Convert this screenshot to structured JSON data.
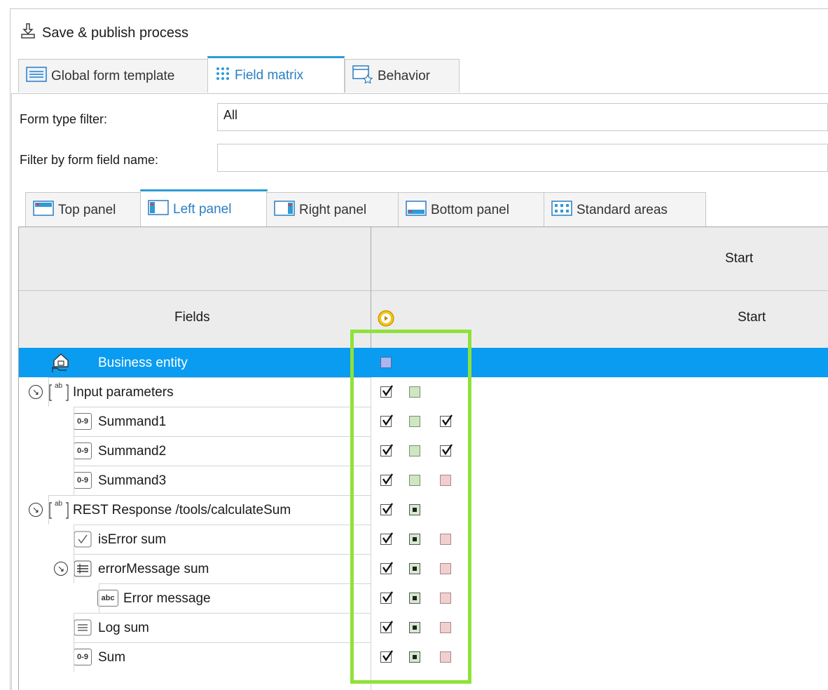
{
  "toolbar": {
    "save_label": "Save & publish process"
  },
  "top_tabs": [
    {
      "label": "Global form template",
      "icon": "form-template-icon"
    },
    {
      "label": "Field matrix",
      "icon": "field-matrix-icon"
    },
    {
      "label": "Behavior",
      "icon": "behavior-icon"
    }
  ],
  "filters": {
    "form_type_label": "Form type filter:",
    "form_type_value": "All",
    "field_name_label": "Filter by form field name:",
    "field_name_value": ""
  },
  "panel_tabs": [
    {
      "label": "Top panel"
    },
    {
      "label": "Left panel"
    },
    {
      "label": "Right panel"
    },
    {
      "label": "Bottom panel"
    },
    {
      "label": "Standard areas"
    }
  ],
  "grid": {
    "stage_header": "Start",
    "fields_header": "Fields",
    "activity_header": "Start",
    "rows": [
      {
        "label": "Business entity",
        "icon": "business-entity-icon",
        "selected": true,
        "checks": [
          "blue"
        ]
      },
      {
        "label": "Input parameters",
        "icon": "block-icon",
        "expand": true,
        "checks": [
          "chk",
          "green"
        ]
      },
      {
        "label": "Summand1",
        "icon": "integer-icon",
        "checks": [
          "chk",
          "green",
          "chk"
        ]
      },
      {
        "label": "Summand2",
        "icon": "integer-icon",
        "checks": [
          "chk",
          "green",
          "chk"
        ]
      },
      {
        "label": "Summand3",
        "icon": "integer-icon",
        "checks": [
          "chk",
          "green",
          "pink"
        ]
      },
      {
        "label": "REST Response /tools/calculateSum",
        "icon": "block-icon",
        "expand": true,
        "checks": [
          "chk",
          "dot"
        ]
      },
      {
        "label": "isError sum",
        "icon": "boolean-icon",
        "checks": [
          "chk",
          "dot",
          "pink"
        ]
      },
      {
        "label": "errorMessage sum",
        "icon": "table-icon",
        "expand": true,
        "checks": [
          "chk",
          "dot",
          "pink"
        ]
      },
      {
        "label": "Error message",
        "icon": "string-icon",
        "checks": [
          "chk",
          "dot",
          "pink"
        ]
      },
      {
        "label": "Log sum",
        "icon": "text-icon",
        "checks": [
          "chk",
          "dot",
          "pink"
        ]
      },
      {
        "label": "Sum",
        "icon": "integer-icon",
        "checks": [
          "chk",
          "dot",
          "pink"
        ]
      }
    ]
  },
  "icon_texts": {
    "integer": "0-9",
    "string": "abc",
    "block": "ab"
  },
  "colors": {
    "accent": "#2d9bd8",
    "selection": "#0a9cf0",
    "highlight": "#8fe23a"
  }
}
